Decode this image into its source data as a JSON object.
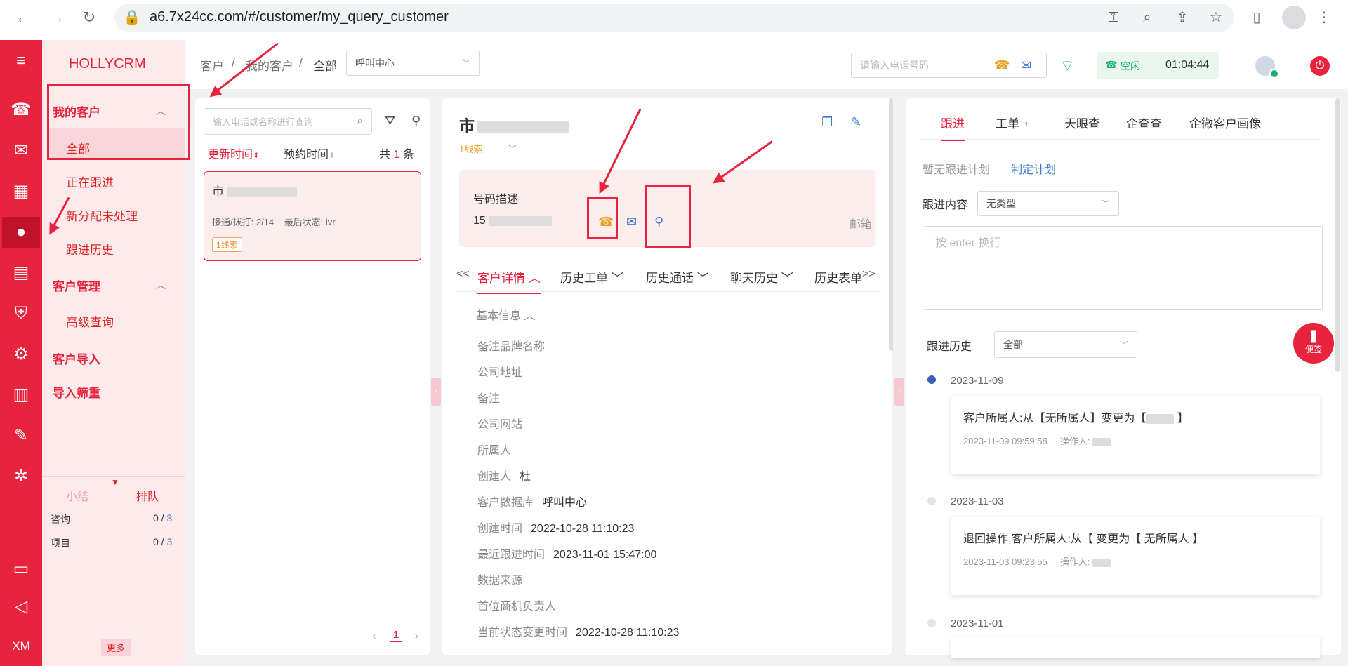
{
  "browser": {
    "url": "a6.7x24cc.com/#/customer/my_query_customer"
  },
  "app": {
    "logo": "HOLLYCRM"
  },
  "sidebar": {
    "groups": [
      {
        "label": "我的客户",
        "items": [
          "全部",
          "正在跟进",
          "新分配未处理",
          "跟进历史"
        ]
      },
      {
        "label": "客户管理",
        "items": [
          "高级查询"
        ]
      },
      {
        "label": "客户导入",
        "items": []
      },
      {
        "label": "导入筛重",
        "items": []
      }
    ],
    "tabs": [
      "小结",
      "排队"
    ],
    "stats": [
      {
        "label": "咨询",
        "value": "0",
        "total": "3"
      },
      {
        "label": "项目",
        "value": "0",
        "total": "3"
      }
    ],
    "more": "更多",
    "rail_bottom": "XM"
  },
  "header": {
    "breadcrumb": [
      "客户",
      "我的客户",
      "全部"
    ],
    "org_select": "呼叫中心",
    "phone_placeholder": "请输入电话号码",
    "status": "空闲",
    "timer": "01:04:44"
  },
  "list": {
    "search_placeholder": "输入电话或名称进行查询",
    "sort_update": "更新时间",
    "sort_appoint": "预约时间",
    "total_prefix": "共",
    "total": "1",
    "total_suffix": "条",
    "items": [
      {
        "name": "市",
        "calls_label": "接通/拨打:",
        "calls": "2/14",
        "last_label": "最后状态:",
        "last": "ivr",
        "tag": "1线索"
      }
    ],
    "page": "1"
  },
  "detail": {
    "name": "市",
    "clue": "1线索",
    "phone_desc": "号码描述",
    "phone": "15",
    "email_label": "邮箱",
    "tabs_prev": "<<",
    "tabs_next": ">>",
    "tabs": [
      "客户详情",
      "历史工单",
      "历史通话",
      "聊天历史",
      "历史表单"
    ],
    "section": "基本信息",
    "fields": [
      {
        "label": "备注品牌名称",
        "value": ""
      },
      {
        "label": "公司地址",
        "value": ""
      },
      {
        "label": "备注",
        "value": ""
      },
      {
        "label": "公司网站",
        "value": ""
      },
      {
        "label": "所属人",
        "value": ""
      },
      {
        "label": "创建人",
        "value": "杜"
      },
      {
        "label": "客户数据库",
        "value": "呼叫中心"
      },
      {
        "label": "创建时间",
        "value": "2022-10-28 11:10:23"
      },
      {
        "label": "最近跟进时间",
        "value": "2023-11-01 15:47:00"
      },
      {
        "label": "数据来源",
        "value": ""
      },
      {
        "label": "首位商机负责人",
        "value": ""
      },
      {
        "label": "当前状态变更时间",
        "value": "2022-10-28 11:10:23"
      }
    ]
  },
  "follow": {
    "tabs": [
      "跟进",
      "工单 +",
      "天眼查",
      "企查查",
      "企微客户画像"
    ],
    "no_plan": "暂无跟进计划",
    "make_plan": "制定计划",
    "content_label": "跟进内容",
    "type_select": "无类型",
    "textarea_placeholder": "按 enter 换行",
    "history_label": "跟进历史",
    "history_select": "全部",
    "sticky": "便签",
    "timeline": [
      {
        "date": "2023-11-09",
        "text": "客户所属人:从【无所属人】变更为【",
        "time": "2023-11-09 09:59:58",
        "op": "操作人:"
      },
      {
        "date": "2023-11-03",
        "text": "退回操作,客户所属人:从【 变更为【 无所属人 】",
        "time": "2023-11-03 09:23:55",
        "op": "操作人:"
      },
      {
        "date": "2023-11-01",
        "text": "",
        "time": "",
        "op": ""
      }
    ]
  },
  "colors": {
    "brand": "#e8233e",
    "status_green": "#1bb36a"
  }
}
